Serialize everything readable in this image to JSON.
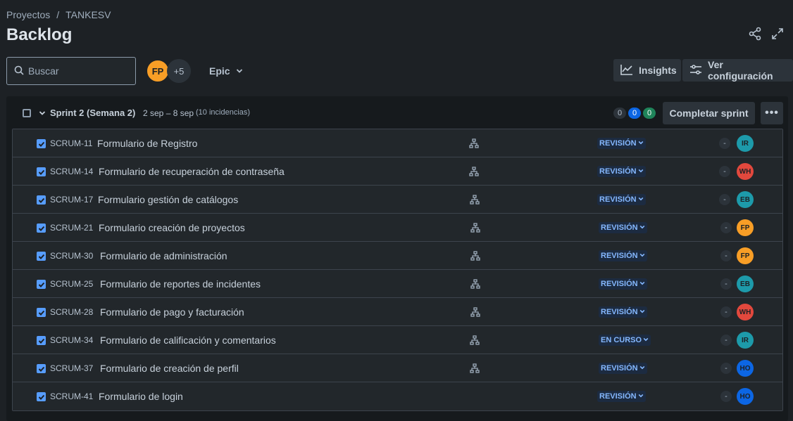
{
  "breadcrumb": {
    "project": "Proyectos",
    "separator": "/",
    "name": "TANKESV"
  },
  "page": {
    "title": "Backlog"
  },
  "search": {
    "placeholder": "Buscar"
  },
  "team": {
    "avatars": [
      {
        "initials": "FP",
        "color": "#f89e26"
      }
    ],
    "more": "+5"
  },
  "filters": {
    "epic_label": "Epic"
  },
  "toolbar": {
    "insights_label": "Insights",
    "config_label": "Ver configuración"
  },
  "sprint": {
    "name": "Sprint 2 (Semana 2)",
    "dates": "2 sep – 8 sep",
    "issue_count": "(10 incidencias)",
    "counts": [
      {
        "value": "0",
        "bg": "#2c333a",
        "fg": "#b6c2cf"
      },
      {
        "value": "0",
        "bg": "#0c66e4",
        "fg": "#ffffff"
      },
      {
        "value": "0",
        "bg": "#1f845a",
        "fg": "#ffffff"
      }
    ],
    "complete_label": "Completar sprint",
    "more_label": "•••"
  },
  "issues": [
    {
      "key": "SCRUM-11",
      "summary": "Formulario de Registro",
      "status": "REVISIÓN",
      "estimate": "-",
      "assignee": "IR",
      "assignee_color": "#1d9aaa"
    },
    {
      "key": "SCRUM-14",
      "summary": "Formulario de recuperación de contraseña",
      "status": "REVISIÓN",
      "estimate": "-",
      "assignee": "WH",
      "assignee_color": "#e2483d"
    },
    {
      "key": "SCRUM-17",
      "summary": "Formulario gestión de catálogos",
      "status": "REVISIÓN",
      "estimate": "-",
      "assignee": "EB",
      "assignee_color": "#1d9aaa"
    },
    {
      "key": "SCRUM-21",
      "summary": "Formulario creación de proyectos",
      "status": "REVISIÓN",
      "estimate": "-",
      "assignee": "FP",
      "assignee_color": "#f89e26"
    },
    {
      "key": "SCRUM-30",
      "summary": "Formulario de administración",
      "status": "REVISIÓN",
      "estimate": "-",
      "assignee": "FP",
      "assignee_color": "#f89e26"
    },
    {
      "key": "SCRUM-25",
      "summary": "Formulario de reportes de incidentes",
      "status": "REVISIÓN",
      "estimate": "-",
      "assignee": "EB",
      "assignee_color": "#1d9aaa"
    },
    {
      "key": "SCRUM-28",
      "summary": "Formulario de pago y facturación",
      "status": "REVISIÓN",
      "estimate": "-",
      "assignee": "WH",
      "assignee_color": "#e2483d"
    },
    {
      "key": "SCRUM-34",
      "summary": "Formulario de calificación y comentarios",
      "status": "EN CURSO",
      "estimate": "-",
      "assignee": "IR",
      "assignee_color": "#1d9aaa"
    },
    {
      "key": "SCRUM-37",
      "summary": "Formulario de creación de perfil",
      "status": "REVISIÓN",
      "estimate": "-",
      "assignee": "HO",
      "assignee_color": "#0c66e4"
    },
    {
      "key": "SCRUM-41",
      "summary": "Formulario de login",
      "status": "REVISIÓN",
      "estimate": "-",
      "assignee": "HO",
      "assignee_color": "#0c66e4"
    }
  ]
}
